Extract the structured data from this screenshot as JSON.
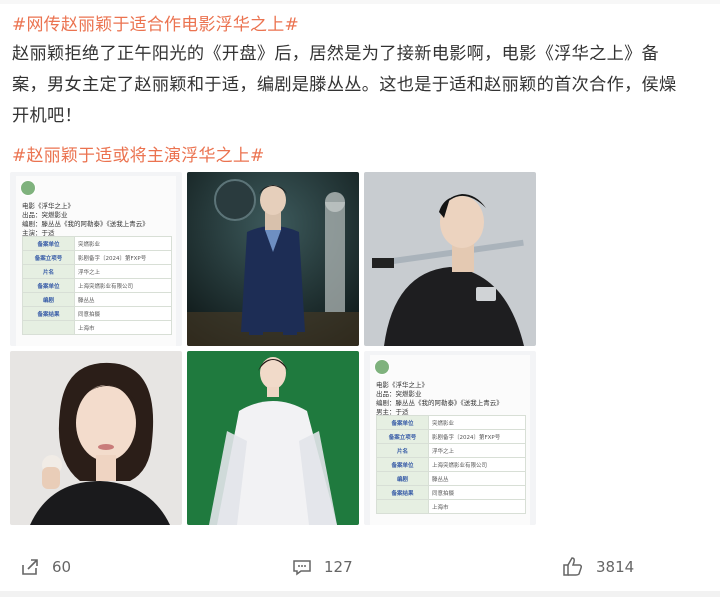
{
  "post": {
    "hashtag_top": "#网传赵丽颖于适合作电影浮华之上#",
    "body_lines": [
      "赵丽颖拒绝了正午阳光的《开盘》后，居然是为了接新电影啊，电影《浮华之上》备",
      "案，男女主定了赵丽颖和于适，编剧是滕丛丛。这也是于适和赵丽颖的首次合作，侯燥",
      "开机吧！"
    ],
    "hashtag_bottom": "#赵丽颖于适或将主演浮华之上#"
  },
  "images": {
    "doc1": {
      "lines": [
        "电影《浮华之上》",
        "出品：突燃影业",
        "编剧：滕丛丛《我的阿勒泰》《送我上青云》",
        "主演：于适"
      ],
      "rows": [
        [
          "备案单位",
          "突燃影业"
        ],
        [
          "备案立项号",
          "影剧备字〔2024〕第FXP号"
        ],
        [
          "片名",
          "浮华之上"
        ],
        [
          "备案单位",
          "上海突燃影业有限公司"
        ],
        [
          "编剧",
          "滕丛丛"
        ],
        [
          "备案结果",
          "同意拍摄"
        ],
        [
          "",
          "上海市"
        ]
      ]
    },
    "doc2": {
      "lines": [
        "电影《浮华之上》",
        "出品：突燃影业",
        "编剧：滕丛丛《我的阿勒泰》《送我上青云》",
        "男主：于适"
      ],
      "rows": [
        [
          "备案单位",
          "突燃影业"
        ],
        [
          "备案立项号",
          "影剧备字〔2024〕第FXP号"
        ],
        [
          "片名",
          "浮华之上"
        ],
        [
          "备案单位",
          "上海突燃影业有限公司"
        ],
        [
          "编剧",
          "滕丛丛"
        ],
        [
          "备案结果",
          "同意拍摄"
        ],
        [
          "",
          "上海市"
        ]
      ]
    }
  },
  "actions": {
    "repost_count": "60",
    "comment_count": "127",
    "like_count": "3814"
  },
  "colors": {
    "hashtag": "#eb7350",
    "text": "#333333",
    "muted": "#666666"
  },
  "icons": [
    "repost-icon",
    "comment-icon",
    "like-icon"
  ]
}
